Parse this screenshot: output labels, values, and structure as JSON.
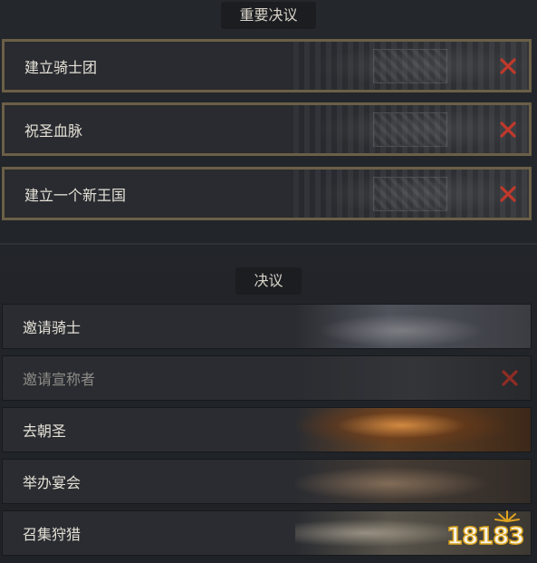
{
  "sections": {
    "important": {
      "title": "重要决议"
    },
    "normal": {
      "title": "决议"
    }
  },
  "important_decisions": [
    {
      "label": "建立骑士团",
      "available": false
    },
    {
      "label": "祝圣血脉",
      "available": false
    },
    {
      "label": "建立一个新王国",
      "available": false
    }
  ],
  "decisions": [
    {
      "label": "邀请骑士",
      "available": true
    },
    {
      "label": "邀请宣称者",
      "available": false
    },
    {
      "label": "去朝圣",
      "available": true
    },
    {
      "label": "举办宴会",
      "available": true
    },
    {
      "label": "召集狩猎",
      "available": true
    }
  ],
  "icons": {
    "unavailable": "close-icon"
  },
  "colors": {
    "unavailable_x": "#c0392b",
    "frame_gold": "#6b5f48",
    "text": "#e4e0d6",
    "text_disabled": "#8e8c88"
  },
  "watermark": {
    "text": "18183"
  }
}
